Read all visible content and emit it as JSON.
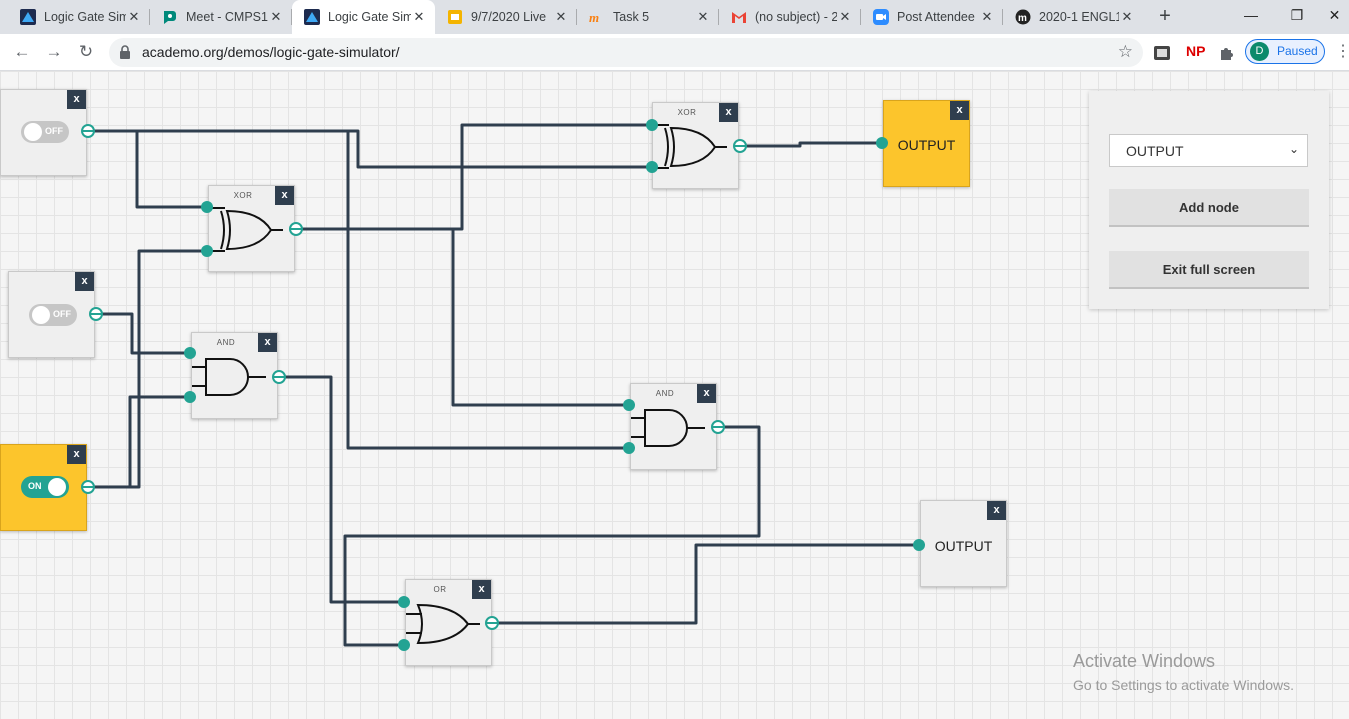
{
  "browser": {
    "tabs": [
      {
        "label": "Logic Gate Simulator",
        "icon": "academo-icon",
        "active": false
      },
      {
        "label": "Meet - CMPS1",
        "icon": "google-meet-icon",
        "active": false
      },
      {
        "label": "Logic Gate Simulator",
        "icon": "academo-icon",
        "active": true
      },
      {
        "label": "9/7/2020 Live",
        "icon": "google-slides-icon",
        "active": false
      },
      {
        "label": "Task 5",
        "icon": "moodle-icon",
        "active": false
      },
      {
        "label": "(no subject) - 2",
        "icon": "gmail-icon",
        "active": false
      },
      {
        "label": "Post Attendee",
        "icon": "zoom-icon",
        "active": false
      },
      {
        "label": "2020-1 ENGL1",
        "icon": "moodle-m-icon",
        "active": false
      }
    ],
    "new_tab": "+",
    "window_controls": {
      "minimize": "—",
      "restore": "❐",
      "close": "✕"
    },
    "url": "academo.org/demos/logic-gate-simulator/",
    "extension_badge": "NP",
    "profile": {
      "initial": "D",
      "status": "Paused"
    }
  },
  "simulator": {
    "inputs": [
      {
        "state_label": "OFF",
        "on": false
      },
      {
        "state_label": "OFF",
        "on": false
      },
      {
        "state_label": "ON",
        "on": true
      }
    ],
    "gates": [
      {
        "title": "XOR",
        "type": "xor"
      },
      {
        "title": "XOR",
        "type": "xor"
      },
      {
        "title": "AND",
        "type": "and"
      },
      {
        "title": "AND",
        "type": "and"
      },
      {
        "title": "OR",
        "type": "or"
      }
    ],
    "outputs": [
      {
        "label": "OUTPUT",
        "on": true
      },
      {
        "label": "OUTPUT",
        "on": false
      }
    ],
    "close_symbol": "x"
  },
  "panel": {
    "select_value": "OUTPUT",
    "add_node_label": "Add node",
    "exit_fullscreen_label": "Exit full screen"
  },
  "watermark": {
    "title": "Activate Windows",
    "subtitle": "Go to Settings to activate Windows."
  },
  "colors": {
    "accent": "#23a393",
    "wire": "#2f3e4e",
    "active_node": "#fcc52c",
    "close_button": "#2f3e4e"
  }
}
